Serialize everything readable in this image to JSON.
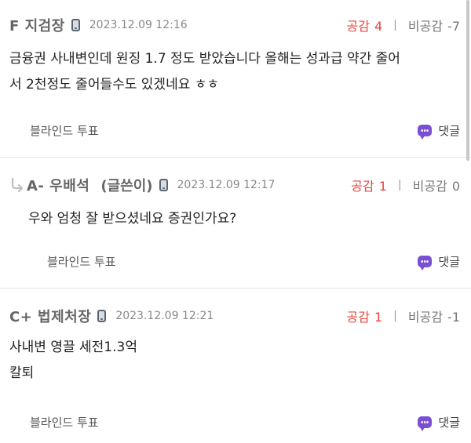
{
  "comments": [
    {
      "author": "F 지검장",
      "timestamp": "2023.12.09 12:16",
      "upvote_label": "공감",
      "upvote_count": "4",
      "downvote_label": "비공감",
      "downvote_count": "-7",
      "body": "금융권 사내변인데 원징 1.7 정도 받았습니다 올해는 성과급 약간 줄어\n서 2천정도 줄어들수도 있겠네요 ㅎㅎ",
      "poll_label": "블라인드 투표",
      "reply_label": "댓글"
    },
    {
      "author": "A- 우배석",
      "writer_tag": "(글쓴이)",
      "timestamp": "2023.12.09 12:17",
      "upvote_label": "공감",
      "upvote_count": "1",
      "downvote_label": "비공감",
      "downvote_count": "0",
      "body": "우와 엄청 잘 받으셨네요 증권인가요?",
      "poll_label": "블라인드 투표",
      "reply_label": "댓글"
    },
    {
      "author": "C+ 법제처장",
      "timestamp": "2023.12.09 12:21",
      "upvote_label": "공감",
      "upvote_count": "1",
      "downvote_label": "비공감",
      "downvote_count": "-1",
      "body": "사내변 영끌 세전1.3억\n칼퇴",
      "poll_label": "블라인드 투표",
      "reply_label": "댓글"
    }
  ],
  "icons": {
    "device": "phone-icon",
    "reply_indent": "reply-arrow-icon",
    "comment": "chat-bubble-icon"
  },
  "colors": {
    "upvote": "#e8453c",
    "comment_icon": "#7b4fd1"
  }
}
